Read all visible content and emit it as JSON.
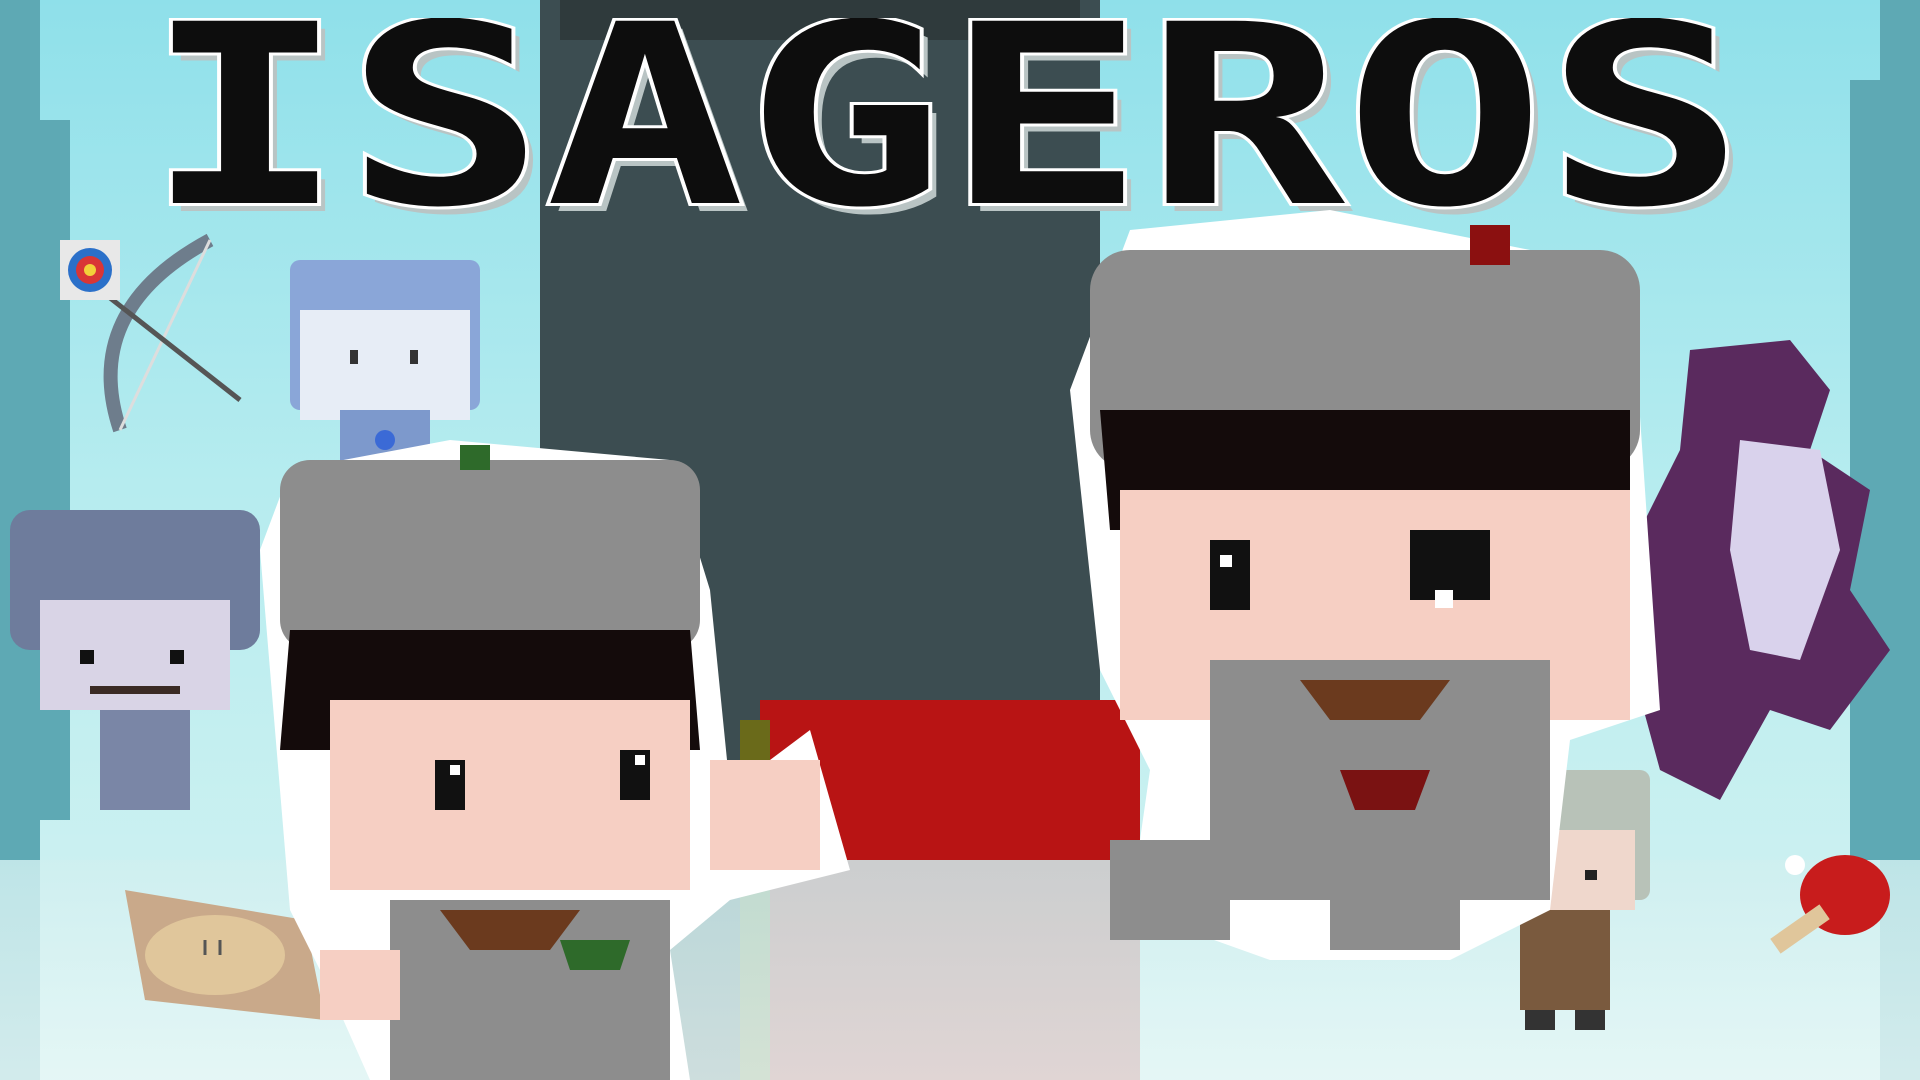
{
  "title": "ISAGEROS",
  "colors": {
    "sky": "#9fe3ea",
    "tower": "#3c4d51",
    "door": "#b81414",
    "title_fill": "#0d0d0d",
    "title_shade": "#b9c4c4",
    "helmet": "#8d8d8d",
    "hair": "#140b0b",
    "skin": "#f6cfc3"
  },
  "icons": [
    "archery-target-icon",
    "bow-icon",
    "lantern-icon",
    "ping-pong-paddle-icon"
  ]
}
